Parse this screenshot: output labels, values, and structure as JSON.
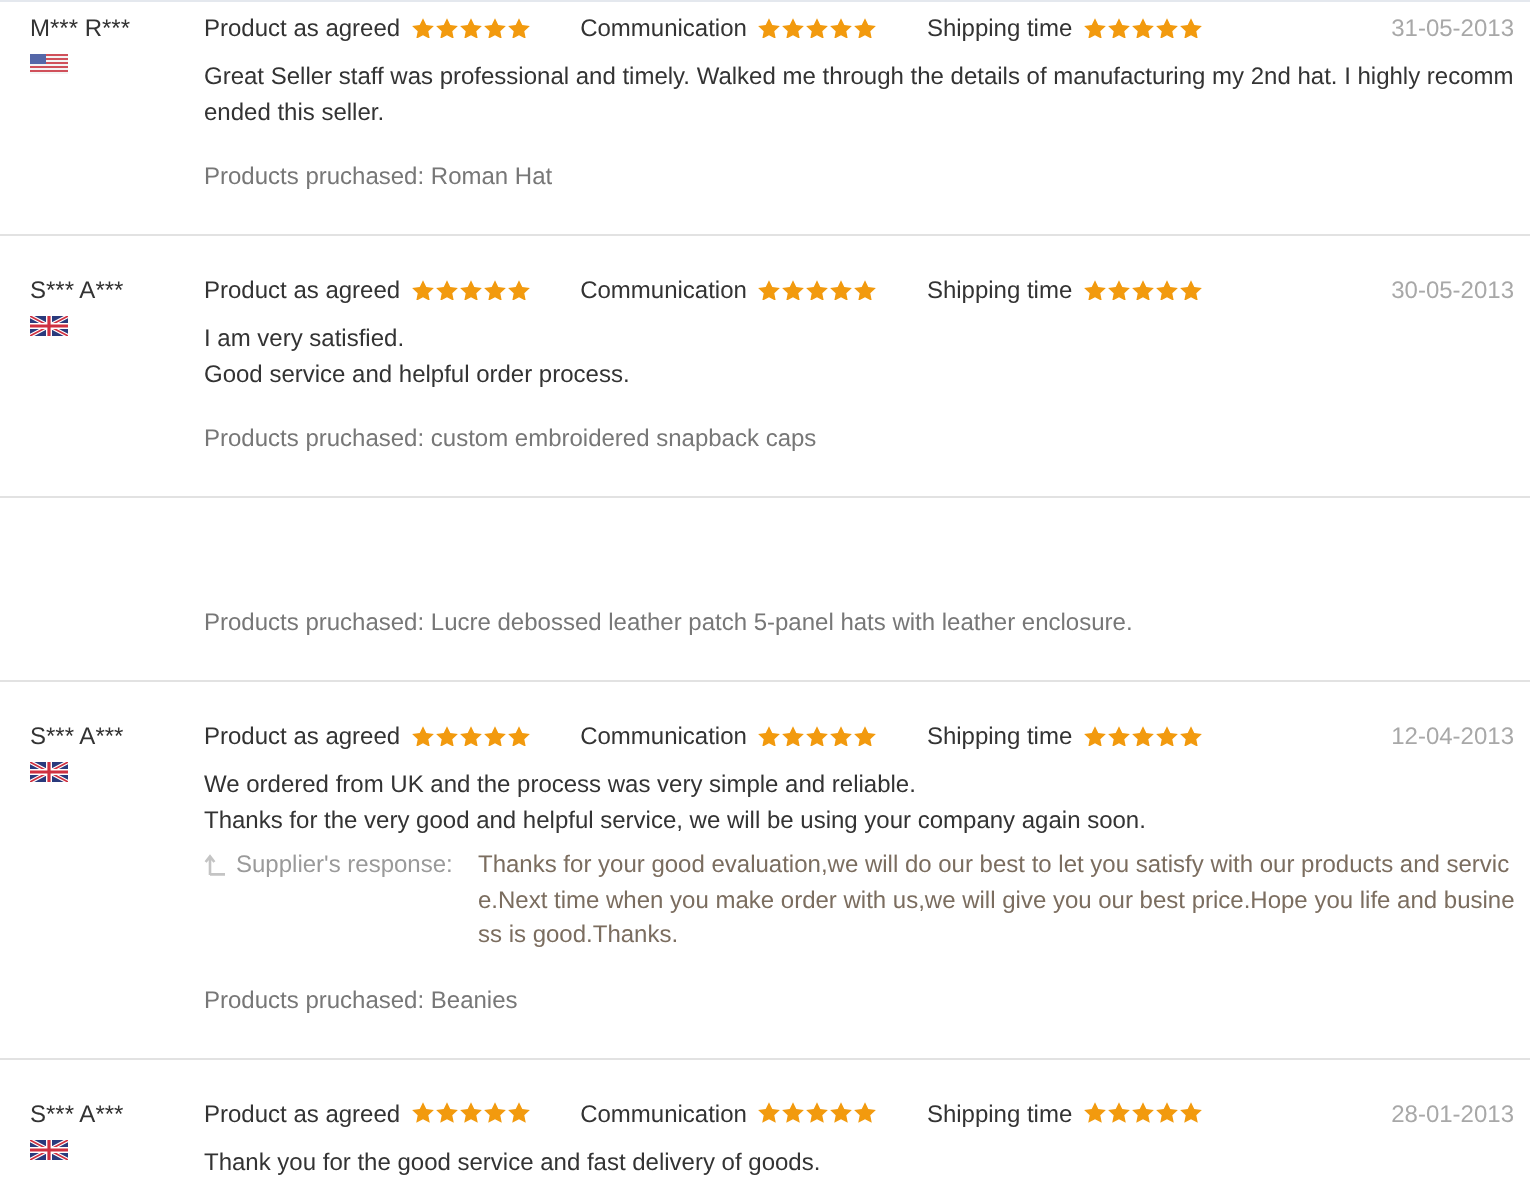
{
  "reviews": [
    {
      "reviewer": "M*** R***",
      "flag": {
        "kind": "us"
      },
      "ratings": [
        {
          "label": "Product as agreed",
          "stars": 5
        },
        {
          "label": "Communication",
          "stars": 5
        },
        {
          "label": "Shipping time",
          "stars": 5
        }
      ],
      "date": "31-05-2013",
      "comment": [
        "Great Seller staff was professional and timely. Walked me through the details of manufacturing my 2nd hat. I highly recommended this seller."
      ],
      "purchased": "Products pruchased: Roman Hat"
    },
    {
      "reviewer": "S*** A***",
      "flag": {
        "kind": "uk"
      },
      "ratings": [
        {
          "label": "Product as agreed",
          "stars": 5
        },
        {
          "label": "Communication",
          "stars": 5
        },
        {
          "label": "Shipping time",
          "stars": 5
        }
      ],
      "date": "30-05-2013",
      "comment": [
        "I am very satisfied.",
        "Good service and helpful order process."
      ],
      "purchased": "Products pruchased: custom embroidered snapback caps"
    },
    {
      "purchased": "Products pruchased: Lucre debossed leather patch 5-panel hats with leather enclosure."
    },
    {
      "reviewer": "S*** A***",
      "flag": {
        "kind": "uk"
      },
      "ratings": [
        {
          "label": "Product as agreed",
          "stars": 5
        },
        {
          "label": "Communication",
          "stars": 5
        },
        {
          "label": "Shipping time",
          "stars": 5
        }
      ],
      "date": "12-04-2013",
      "comment": [
        "We ordered from UK and the process was very simple and reliable.",
        "Thanks for the very good and helpful service, we will be using your company again soon."
      ],
      "response": {
        "label": "Supplier's response:",
        "text": "Thanks for your good evaluation,we will do our best to let you satisfy with our products and service.Next time when you make order with us,we will give you our best price.Hope you life and business is good.Thanks."
      },
      "purchased": "Products pruchased: Beanies"
    },
    {
      "reviewer": "S*** A***",
      "flag": {
        "kind": "uk"
      },
      "ratings": [
        {
          "label": "Product as agreed",
          "stars": 5
        },
        {
          "label": "Communication",
          "stars": 5
        },
        {
          "label": "Shipping time",
          "stars": 5
        }
      ],
      "date": "28-01-2013",
      "comment": [
        "Thank you for the good service and fast delivery of goods."
      ]
    }
  ]
}
